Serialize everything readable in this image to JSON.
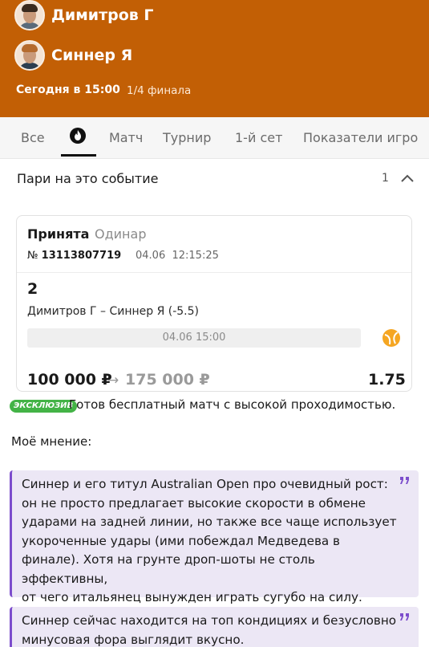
{
  "header": {
    "player1": "Димитров Г",
    "player2": "Синнер Я",
    "match_time": "Сегодня в 15:00",
    "stage": "1/4 финала",
    "bg_color": "#c25f05"
  },
  "tabs": {
    "items": [
      "Все",
      "Матч",
      "Турнир",
      "1-й сет",
      "Показатели игро"
    ],
    "active_icon": "fire-icon"
  },
  "bets": {
    "title": "Пари на это событие",
    "count": "1",
    "card": {
      "status": "Принята",
      "type": "Одинар",
      "number_prefix": "№",
      "number": "13113807719",
      "date": "04.06  12:15:25",
      "outcome": "2",
      "event": "Димитров Г – Синнер Я (-5.5)",
      "event_time": "04.06 15:00",
      "stake": "100 000 ₽",
      "arrow": "→",
      "payout": "175 000 ₽",
      "odds": "1.75",
      "sport_icon": "tennis-ball-icon"
    }
  },
  "message": {
    "badge": "ЭКСКЛЮЗИВ",
    "intro": "Готов бесплатный матч с высокой проходимостью.",
    "opinion_label": "Моё мнение:",
    "quote1_lines": [
      "Синнер и его титул Australian Open про очевидный рост:",
      "он не просто предлагает высокие скорости в обмене",
      "ударами на задней линии, но также все чаще использует",
      "укороченные удары (ими побеждал Медведева в",
      "финале). Хотя на грунте дроп-шоты не столь эффективны,",
      "от чего итальянец вынужден играть сугубо на силу."
    ],
    "quote2_lines": [
      "Синнер сейчас находится на топ кондициях и безусловно",
      "минусовая фора выглядит вкусно."
    ],
    "accent_color": "#7c4dcc"
  }
}
